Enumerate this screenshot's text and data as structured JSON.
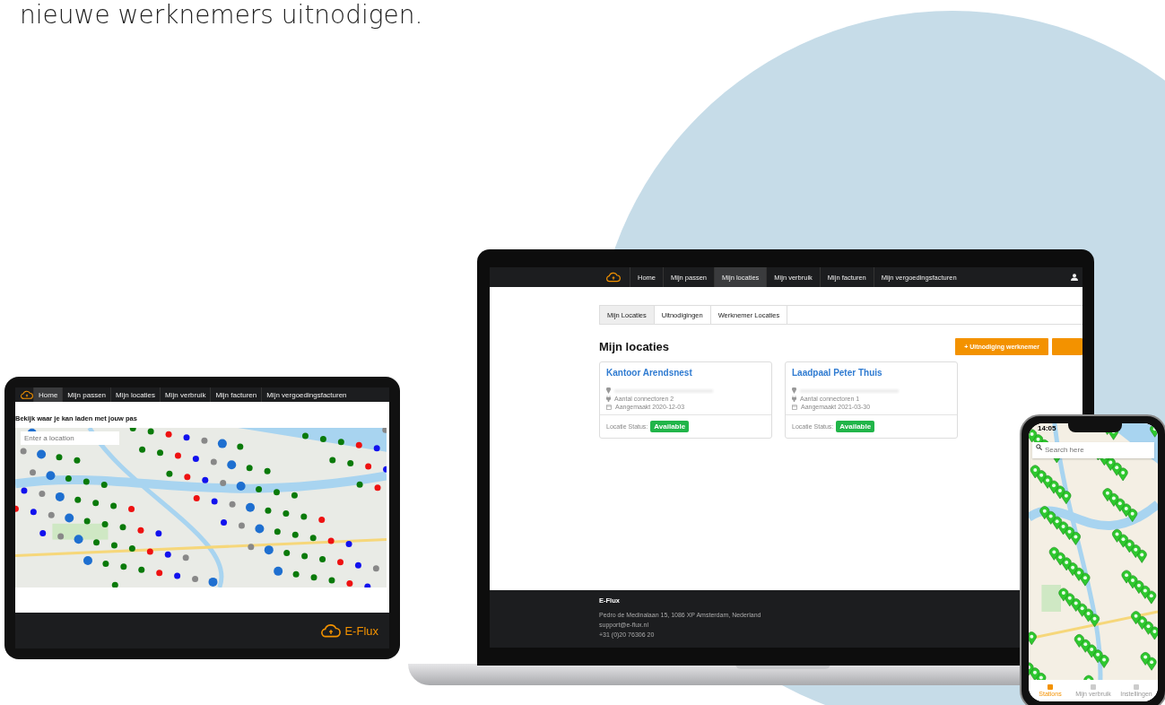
{
  "heading": "nieuwe werknemers uitnodigen.",
  "tablet": {
    "nav": [
      {
        "label": "Home",
        "selected": true
      },
      {
        "label": "Mijn passen",
        "selected": false
      },
      {
        "label": "Mijn locaties",
        "selected": false
      },
      {
        "label": "Mijn verbruik",
        "selected": false
      },
      {
        "label": "Mijn facturen",
        "selected": false
      },
      {
        "label": "Mijn vergoedingsfacturen",
        "selected": false
      }
    ],
    "title": "Bekijk waar je kan laden met jouw pas",
    "search": {
      "placeholder": "Enter a location"
    },
    "footer_logo": "E-Flux"
  },
  "laptop": {
    "nav": [
      {
        "label": "Home",
        "selected": false
      },
      {
        "label": "Mijn passen",
        "selected": false
      },
      {
        "label": "Mijn locaties",
        "selected": true
      },
      {
        "label": "Mijn verbruik",
        "selected": false
      },
      {
        "label": "Mijn facturen",
        "selected": false
      },
      {
        "label": "Mijn vergoedingsfacturen",
        "selected": false
      }
    ],
    "tabs": [
      {
        "label": "Mijn Locaties",
        "selected": true
      },
      {
        "label": "Uitnodigingen",
        "selected": false
      },
      {
        "label": "Werknemer Locaties",
        "selected": false
      }
    ],
    "title": "Mijn locaties",
    "actions": [
      {
        "kind": "labeled",
        "icon": "+",
        "label": "Uitnodiging werknemer"
      },
      {
        "kind": "cut"
      }
    ],
    "cards": [
      {
        "name": "Kantoor Arendsnest",
        "connectors": "Aantal connectoren 2",
        "created": "Aangemaakt 2020-12-03",
        "status_label": "Locatie Status:",
        "status": "Available"
      },
      {
        "name": "Laadpaal Peter Thuis",
        "connectors": "Aantal connectoren 1",
        "created": "Aangemaakt 2021-03-30",
        "status_label": "Locatie Status:",
        "status": "Available"
      }
    ],
    "footer": {
      "brand": "E-Flux",
      "lines": [
        "Pedro de Medinalaan 15, 1086 XP Amsterdam, Nederland",
        "support@e-flux.nl",
        "+31 (0)20 76306 20"
      ]
    }
  },
  "phone": {
    "time": "14:05",
    "search": {
      "placeholder": "Search here"
    },
    "tabs": [
      {
        "label": "Stations",
        "selected": true
      },
      {
        "label": "Mijn verbruik",
        "selected": false
      },
      {
        "label": "Instellingen",
        "selected": false
      }
    ]
  }
}
